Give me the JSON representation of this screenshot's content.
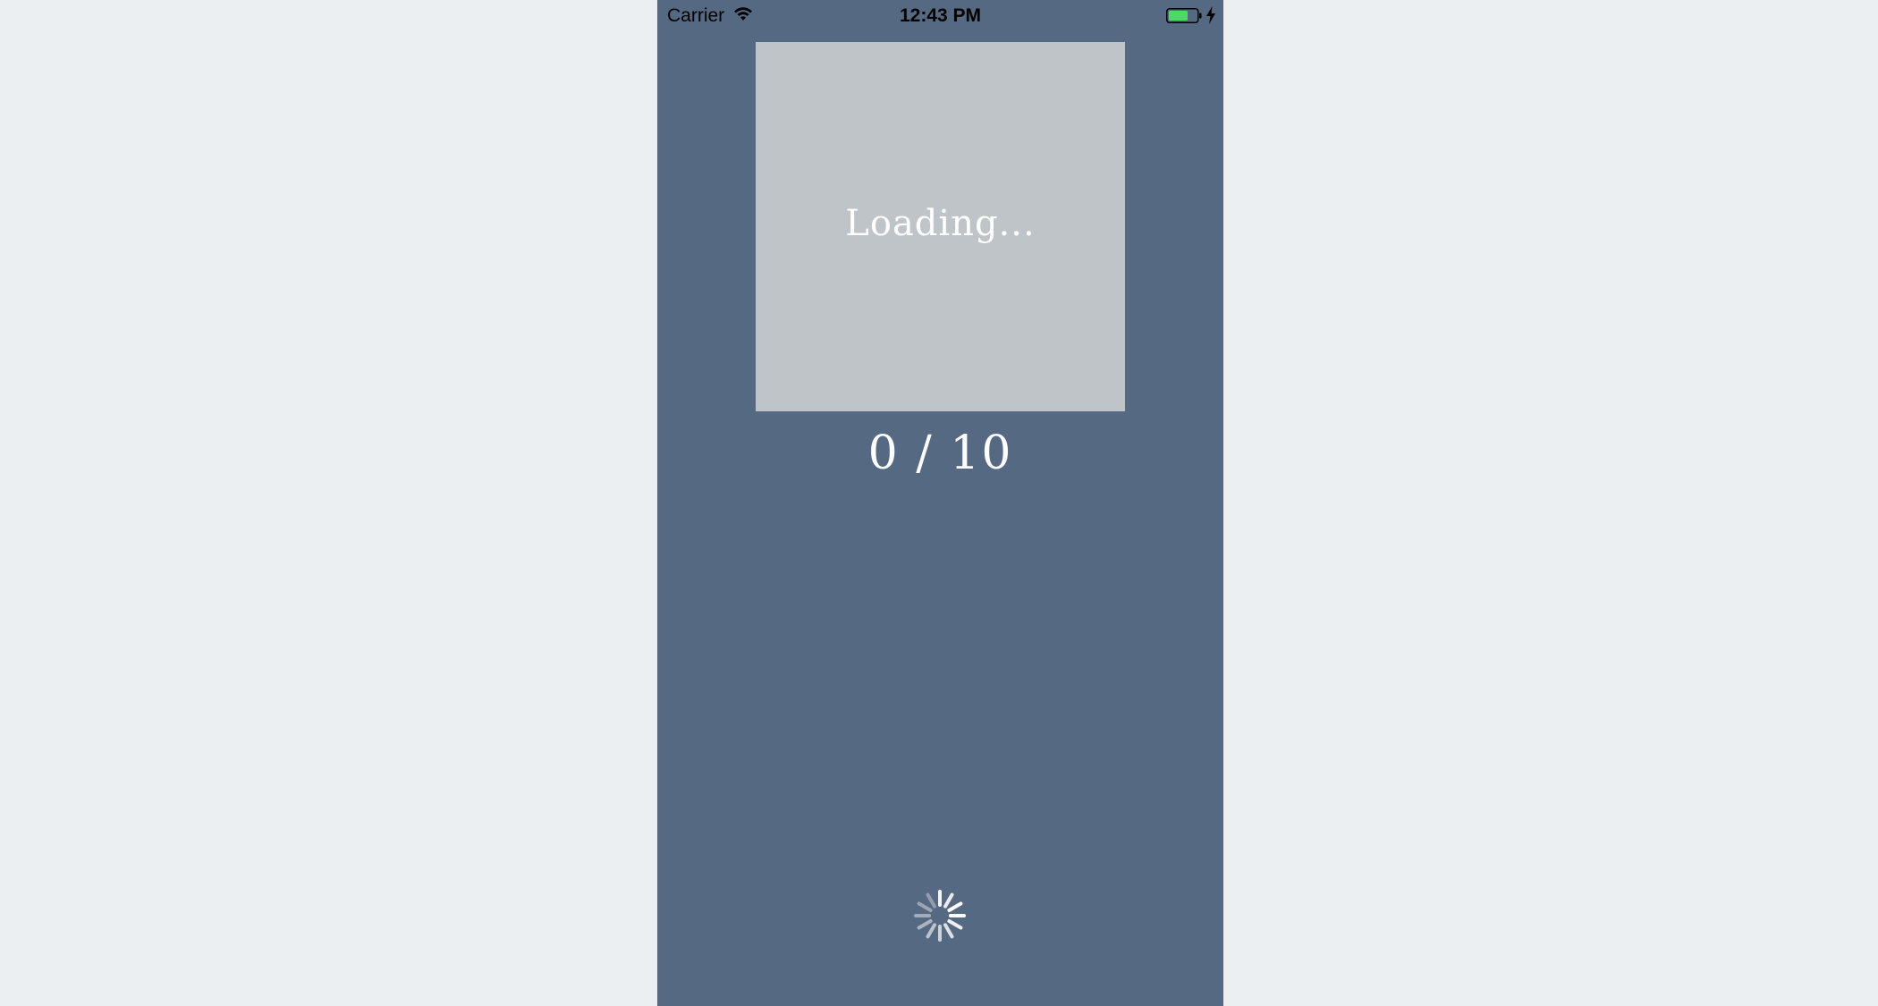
{
  "status_bar": {
    "carrier": "Carrier",
    "time": "12:43 PM",
    "wifi_icon": "wifi-icon",
    "battery_icon": "battery-charging-icon",
    "battery_color": "#4cd964"
  },
  "image_placeholder": {
    "text": "Loading..."
  },
  "counter": {
    "text": "0 / 10"
  },
  "spinner": {
    "icon": "activity-spinner-icon"
  },
  "colors": {
    "background": "#566982",
    "placeholder": "#bfc4c9",
    "page": "#ebeff2"
  }
}
